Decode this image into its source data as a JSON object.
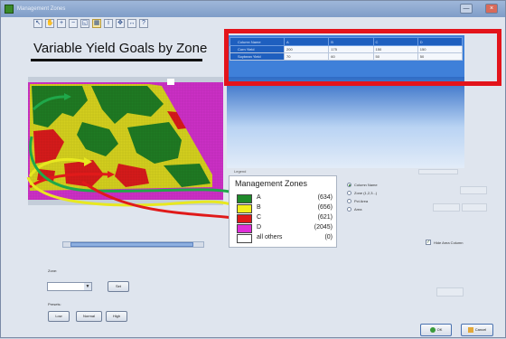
{
  "window": {
    "title": "Management Zones",
    "min_label": "—",
    "close_label": "×"
  },
  "toolbar": {
    "icons": [
      "arrow-icon",
      "hand-icon",
      "zoom-in-icon",
      "zoom-out-icon",
      "extent-icon",
      "select-grid-icon",
      "identify-icon",
      "pan-icon",
      "measure-icon",
      "help-icon"
    ],
    "selected_index": 5
  },
  "map": {
    "title": "Variable Yield Goals by Zone"
  },
  "data_grid": {
    "columns": [
      "Column Name",
      "A",
      "B",
      "C",
      "D"
    ],
    "rows": [
      {
        "name": "Corn Yield",
        "values": [
          "200",
          "175",
          "150",
          "150"
        ]
      },
      {
        "name": "Soybean Yield",
        "values": [
          "70",
          "60",
          "50",
          "50"
        ]
      }
    ]
  },
  "legend": {
    "caption": "Legend",
    "title": "Management Zones",
    "items": [
      {
        "name": "A",
        "count": "(634)",
        "color": "#1f8a2a"
      },
      {
        "name": "B",
        "count": "(656)",
        "color": "#f2ee1c"
      },
      {
        "name": "C",
        "count": "(621)",
        "color": "#e01a1a"
      },
      {
        "name": "D",
        "count": "(2045)",
        "color": "#e02ed8"
      },
      {
        "name": "all others",
        "count": "(0)",
        "color": "#ffffff"
      }
    ]
  },
  "options": {
    "radios": [
      {
        "label": "Column Name",
        "selected": true
      },
      {
        "label": "Zone (1,2,3...)",
        "selected": false
      },
      {
        "label": "Pct Area",
        "selected": false
      },
      {
        "label": "Area",
        "selected": false
      }
    ],
    "hide_area_checkbox": {
      "label": "Hide Area Column",
      "checked": true
    }
  },
  "bottom": {
    "zone_label": "Zone:",
    "set_label": "Set",
    "presets_label": "Presets:",
    "low_label": "Low",
    "normal_label": "Normal",
    "high_label": "High",
    "ok_label": "OK",
    "cancel_label": "Cancel"
  }
}
